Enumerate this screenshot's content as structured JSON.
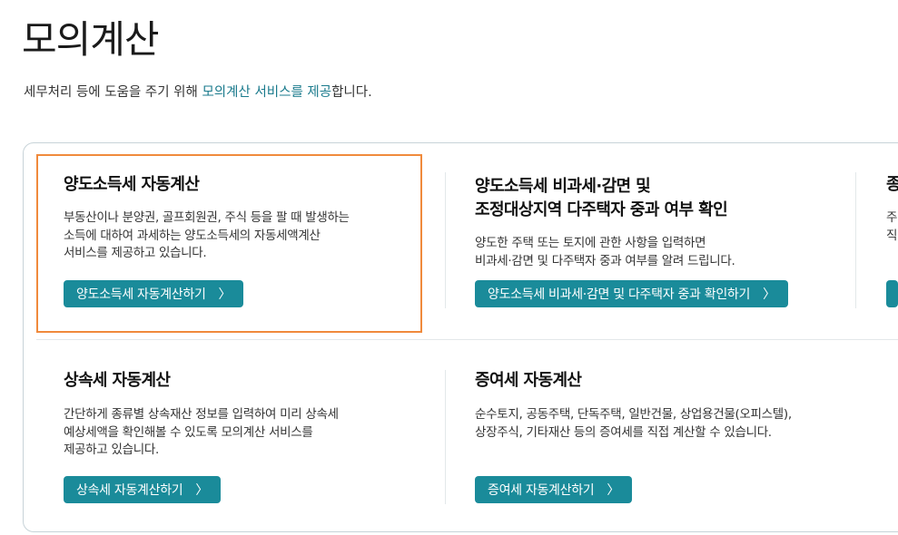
{
  "page": {
    "title": "모의계산",
    "intro_prefix": "세무처리 등에 도움을 주기 위해 ",
    "intro_highlight": "모의계산 서비스를 제공",
    "intro_suffix": "합니다."
  },
  "cards": [
    {
      "title": "양도소득세 자동계산",
      "desc_lines": [
        "부동산이나 분양권, 골프회원권, 주식 등을 팔 때 발생하는",
        "소득에 대하여 과세하는 양도소득세의 자동세액계산",
        "서비스를 제공하고 있습니다."
      ],
      "button_label": "양도소득세 자동계산하기"
    },
    {
      "title_lines": [
        "양도소득세 비과세·감면 및",
        "조정대상지역 다주택자 중과 여부 확인"
      ],
      "desc_lines": [
        "양도한 주택 또는 토지에 관한 사항을 입력하면",
        "비과세·감면 및 다주택자 중과 여부를 알려 드립니다."
      ],
      "button_label": "양도소득세 비과세·감면 및 다주택자 중과 확인하기"
    },
    {
      "title": "종",
      "desc_lines": [
        "주",
        "직"
      ]
    },
    {
      "title": "상속세 자동계산",
      "desc_lines": [
        "간단하게 종류별 상속재산 정보를 입력하여 미리 상속세",
        "예상세액을 확인해볼 수 있도록 모의계산 서비스를",
        "제공하고 있습니다."
      ],
      "button_label": "상속세 자동계산하기"
    },
    {
      "title": "증여세 자동계산",
      "desc_lines": [
        "순수토지, 공동주택, 단독주택, 일반건물, 상업용건물(오피스텔),",
        "상장주식, 기타재산 등의 증여세를 직접 계산할 수 있습니다."
      ],
      "button_label": "증여세 자동계산하기"
    }
  ],
  "icons": {
    "button_arrow": "chevron-right-icon",
    "arrow_glyph": "〉"
  },
  "colors": {
    "accent": "#1a8b9a",
    "highlight_border": "#f08a3c",
    "link_text": "#1a7a8c"
  }
}
